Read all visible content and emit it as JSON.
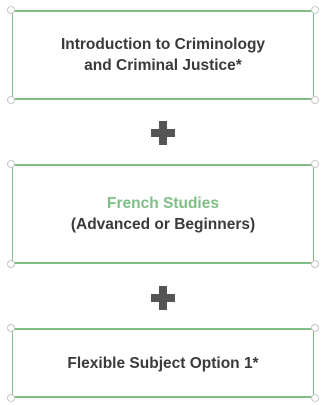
{
  "boxes": [
    {
      "lines": [
        "Introduction to Criminology",
        "and Criminal Justice*"
      ]
    },
    {
      "lines": [
        "French Studies",
        "(Advanced or Beginners)"
      ]
    },
    {
      "lines": [
        "Flexible Subject Option 1*"
      ]
    }
  ],
  "connector_symbol": "plus-icon",
  "colors": {
    "border": "#7fbf86",
    "accent_text": "#7fbf86",
    "text": "#3a3a3a",
    "plus": "#555555"
  }
}
